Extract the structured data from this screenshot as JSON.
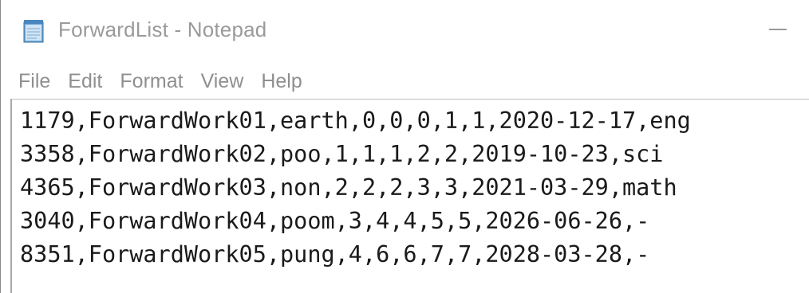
{
  "window": {
    "title": "ForwardList - Notepad",
    "icon": "notepad-icon",
    "minimize_icon": "minimize-icon"
  },
  "menu": {
    "items": [
      {
        "label": "File"
      },
      {
        "label": "Edit"
      },
      {
        "label": "Format"
      },
      {
        "label": "View"
      },
      {
        "label": "Help"
      }
    ]
  },
  "editor": {
    "lines": [
      "1179,ForwardWork01,earth,0,0,0,1,1,2020-12-17,eng",
      "3358,ForwardWork02,poo,1,1,1,2,2,2019-10-23,sci",
      "4365,ForwardWork03,non,2,2,2,3,3,2021-03-29,math",
      "3040,ForwardWork04,poom,3,4,4,5,5,2026-06-26,-",
      "8351,ForwardWork05,pung,4,6,6,7,7,2028-03-28,-"
    ]
  }
}
